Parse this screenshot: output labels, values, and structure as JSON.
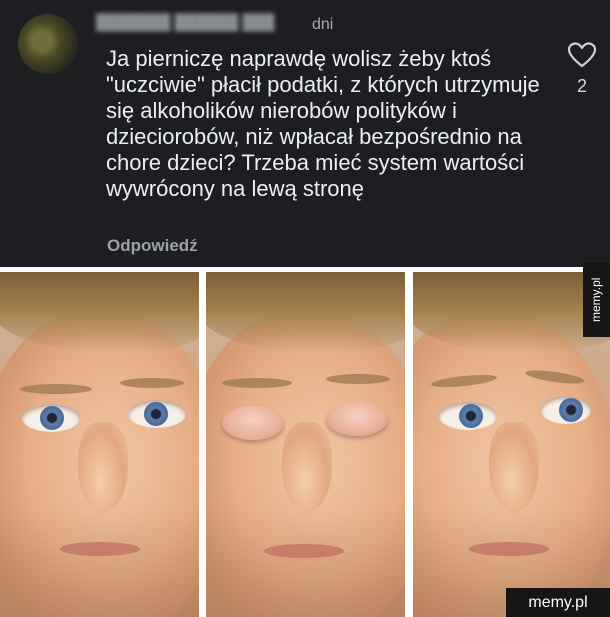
{
  "comment": {
    "header_tail": "dni",
    "text": "Ja pierniczę naprawdę wolisz żeby ktoś \"uczciwie\" płacił podatki, z których utrzymuje się alkoholików nierobów polityków i dzieciorobów, niż wpłacał bezpośrednio na chore dzieci? Trzeba mieć system wartości wywrócony na lewą stronę",
    "reply_label": "Odpowiedź",
    "like_count": "2",
    "like_icon": "heart-outline-icon"
  },
  "meme": {
    "panels": [
      "eyes-open",
      "eyes-closed",
      "eyes-open-puzzled"
    ]
  },
  "watermark": {
    "side": "memy.pl",
    "bottom": "memy.pl"
  }
}
